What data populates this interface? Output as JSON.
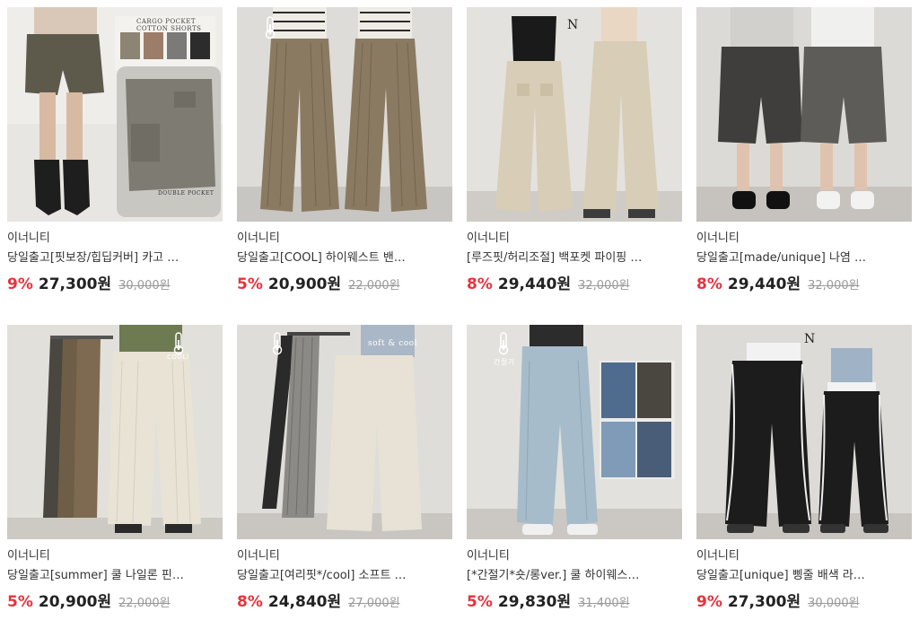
{
  "colors": {
    "discount": "#e8323c",
    "price": "#222222",
    "original_price": "#999999",
    "text": "#333333"
  },
  "products": [
    {
      "brand": "이너니티",
      "title": "당일출고[핏보장/힙딥커버] 카고 …",
      "discount": "9%",
      "price": "27,300원",
      "original_price": "30,000원",
      "image_overlay": [
        "CARGO POCKET COTTON SHORTS",
        "DOUBLE POCKET"
      ]
    },
    {
      "brand": "이너니티",
      "title": "당일출고[COOL] 하이웨스트 밴…",
      "discount": "5%",
      "price": "20,900원",
      "original_price": "22,000원",
      "image_icon": "thermometer-icon"
    },
    {
      "brand": "이너니티",
      "title": "[루즈핏/허리조절] 백포켓 파이핑 …",
      "discount": "8%",
      "price": "29,440원",
      "original_price": "32,000원"
    },
    {
      "brand": "이너니티",
      "title": "당일출고[made/unique] 나염 …",
      "discount": "8%",
      "price": "29,440원",
      "original_price": "32,000원"
    },
    {
      "brand": "이너니티",
      "title": "당일출고[summer] 쿨 나일론 핀…",
      "discount": "5%",
      "price": "20,900원",
      "original_price": "22,000원",
      "image_icon": "thermometer-icon",
      "image_overlay": [
        "COOL!"
      ]
    },
    {
      "brand": "이너니티",
      "title": "당일출고[여리핏*/cool] 소프트 …",
      "discount": "8%",
      "price": "24,840원",
      "original_price": "27,000원",
      "image_icon": "thermometer-icon",
      "image_overlay": [
        "soft & cool"
      ]
    },
    {
      "brand": "이너니티",
      "title": "[*간절기*숏/롱ver.] 쿨 하이웨스…",
      "discount": "5%",
      "price": "29,830원",
      "original_price": "31,400원",
      "image_icon": "thermometer-icon",
      "image_overlay": [
        "간절기"
      ]
    },
    {
      "brand": "이너니티",
      "title": "당일출고[unique] 삥줄 배색 라…",
      "discount": "9%",
      "price": "27,300원",
      "original_price": "30,000원"
    }
  ]
}
